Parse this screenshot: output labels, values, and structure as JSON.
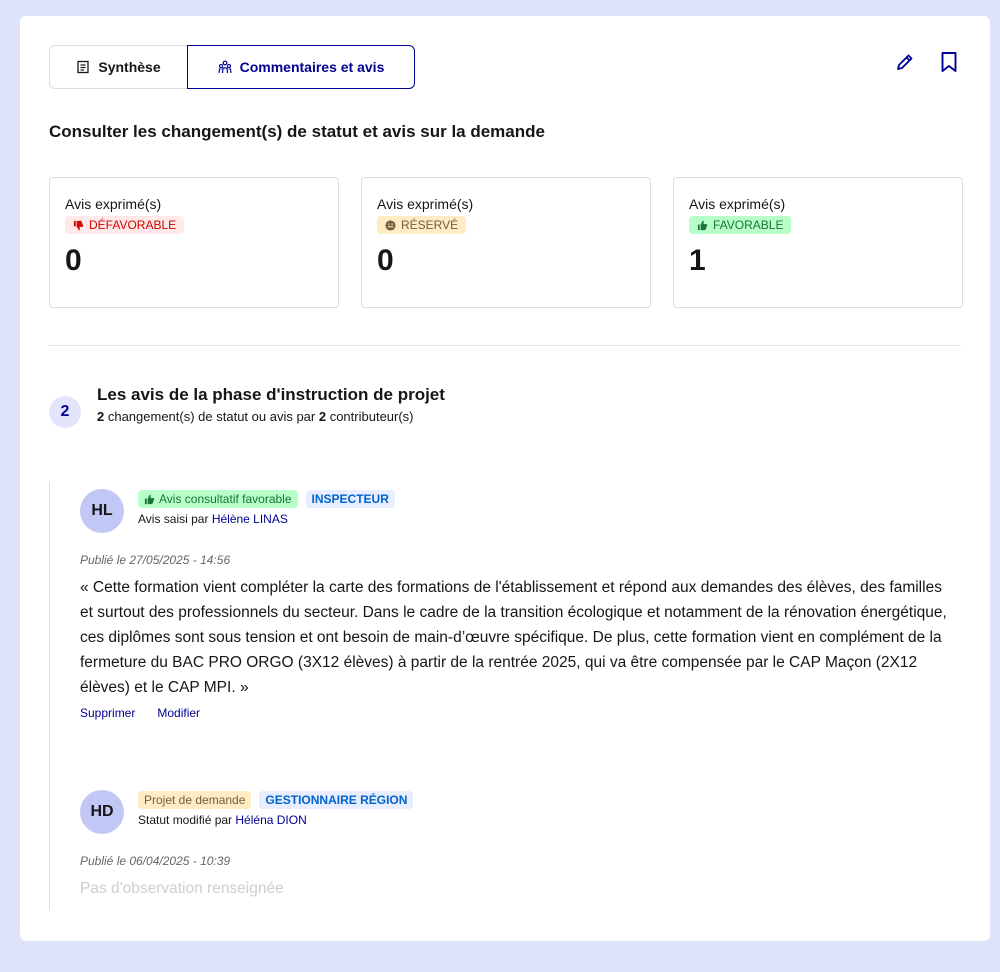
{
  "tabs": [
    {
      "label": "Synthèse",
      "icon": "document-icon",
      "active": false
    },
    {
      "label": "Commentaires et avis",
      "icon": "people-icon",
      "active": true
    }
  ],
  "toolbar": {
    "edit_icon": "pencil-icon",
    "bookmark_icon": "bookmark-icon"
  },
  "section_title": "Consulter les changement(s) de statut et avis sur la demande",
  "stats": [
    {
      "label": "Avis exprimé(s)",
      "badge": "DÉFAVORABLE",
      "icon": "thumbs-down-icon",
      "value": "0",
      "color": "#ce0500"
    },
    {
      "label": "Avis exprimé(s)",
      "badge": "RÉSERVÉ",
      "icon": "neutral-face-icon",
      "value": "0",
      "color": "#716043"
    },
    {
      "label": "Avis exprimé(s)",
      "badge": "FAVORABLE",
      "icon": "thumbs-up-icon",
      "value": "1",
      "color": "#18753c"
    }
  ],
  "phase": {
    "count": "2",
    "title": "Les avis de la phase d'instruction de projet",
    "subtitle_prefix_count": "2",
    "subtitle_middle": " changement(s) de statut ou avis par ",
    "subtitle_contrib_count": "2",
    "subtitle_suffix": " contributeur(s)"
  },
  "entries": [
    {
      "initials": "HL",
      "status_tag": "Avis consultatif favorable",
      "role_tag": "INSPECTEUR",
      "by_prefix": "Avis saisi par ",
      "author": "Hélène LINAS",
      "date": "Publié le 27/05/2025 - 14:56",
      "body": "« Cette formation vient compléter la carte des formations de l'établissement et répond aux demandes des élèves, des familles et surtout des professionnels du secteur. Dans le cadre de la transition écologique et notamment de la rénovation énergétique, ces diplômes sont sous tension et ont besoin de main-d’œuvre spécifique. De plus, cette formation vient en complément de la fermeture du BAC PRO ORGO (3X12 élèves) à partir de la rentrée 2025, qui va être compensée par le CAP Maçon (2X12 élèves) et le CAP MPI. »",
      "delete_label": "Supprimer",
      "edit_label": "Modifier"
    },
    {
      "initials": "HD",
      "status_tag": "Projet de demande",
      "role_tag": "GESTIONNAIRE RÉGION",
      "by_prefix": "Statut modifié par ",
      "author": "Héléna DION",
      "date": "Publié le 06/04/2025 - 10:39",
      "body": "Pas d'observation renseignée"
    }
  ]
}
